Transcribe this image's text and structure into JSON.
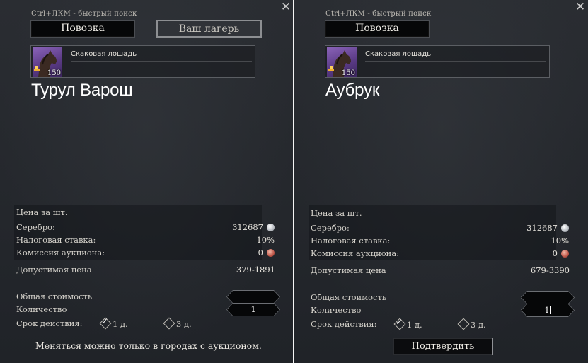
{
  "panels": [
    {
      "close_icon": "close-icon",
      "hint": "Ctrl+ЛКМ - быстрый поиск",
      "tabs": [
        {
          "label": "Повозка",
          "active": true
        },
        {
          "label": "Ваш лагерь",
          "active": false
        }
      ],
      "item": {
        "name": "Скаковая лошадь",
        "count": "150",
        "icon": "horse-icon"
      },
      "city": "Турул Варош",
      "price_per_unit_label": "Цена за шт.",
      "silver_label": "Серебро:",
      "silver_value": "312687",
      "tax_label": "Налоговая ставка:",
      "tax_value": "10%",
      "commission_label": "Комиссия аукциона:",
      "commission_value": "0",
      "allowed_price_label": "Допустимая цена",
      "allowed_price_value": "379-1891",
      "total_cost_label": "Общая стоимость",
      "total_cost_value": "",
      "quantity_label": "Количество",
      "quantity_value": "1",
      "duration_label": "Срок действия:",
      "duration_options": [
        {
          "label": "1 д.",
          "selected": true
        },
        {
          "label": "3 д.",
          "selected": false
        }
      ],
      "notice": "Меняться можно только в городах с аукционом."
    },
    {
      "close_icon": "close-icon",
      "hint": "Ctrl+ЛКМ - быстрый поиск",
      "tabs": [
        {
          "label": "Повозка",
          "active": true
        }
      ],
      "item": {
        "name": "Скаковая лошадь",
        "count": "150",
        "icon": "horse-icon"
      },
      "city": "Аубрук",
      "price_per_unit_label": "Цена за шт.",
      "silver_label": "Серебро:",
      "silver_value": "312687",
      "tax_label": "Налоговая ставка:",
      "tax_value": "10%",
      "commission_label": "Комиссия аукциона:",
      "commission_value": "0",
      "allowed_price_label": "Допустимая цена",
      "allowed_price_value": "679-3390",
      "total_cost_label": "Общая стоимость",
      "total_cost_value": "",
      "quantity_label": "Количество",
      "quantity_value": "1",
      "duration_label": "Срок действия:",
      "duration_options": [
        {
          "label": "1 д.",
          "selected": true
        },
        {
          "label": "3 д.",
          "selected": false
        }
      ],
      "confirm_label": "Подтвердить"
    }
  ]
}
